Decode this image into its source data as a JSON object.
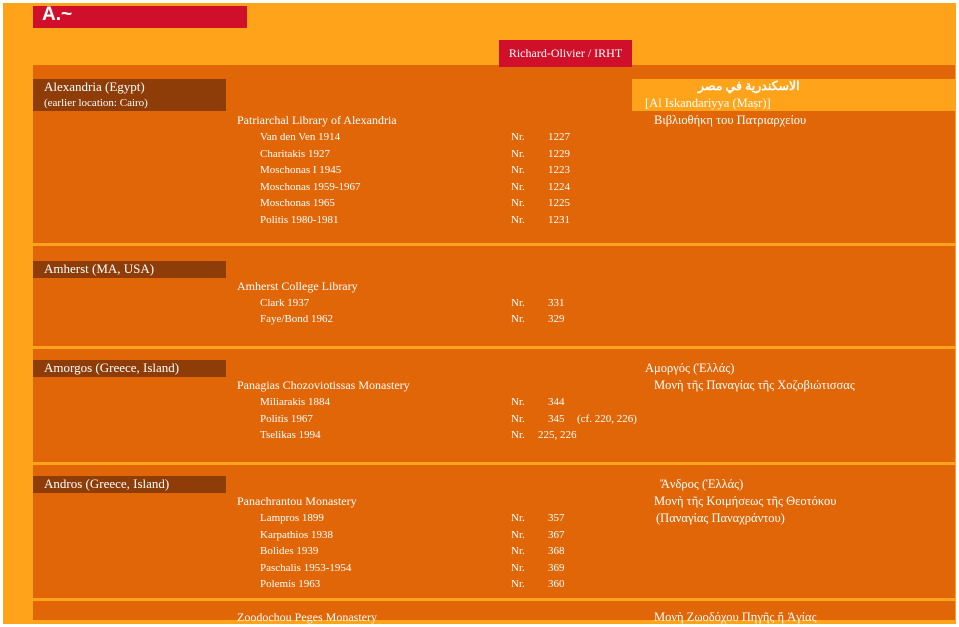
{
  "header": {
    "letter": "A.~"
  },
  "author_label": "Richard-Olivier / IRHT",
  "entries": [
    {
      "location": "Alexandria (Egypt)",
      "location_note": "(earlier location: Cairo)",
      "native_lines": [
        "الاسكندرية في مصر",
        "[Al Iskandariyya (Maṣr)]",
        "Βιβλιοθήκη του Πατριαρχείου"
      ],
      "libraries": [
        {
          "name": "Patriarchal Library of Alexandria",
          "refs": [
            {
              "author": "Van den Ven 1914",
              "prefix": "Nr.",
              "number": "1227",
              "note": ""
            },
            {
              "author": "Charitakis 1927",
              "prefix": "Nr.",
              "number": "1229",
              "note": ""
            },
            {
              "author": "Moschonas I 1945",
              "prefix": "Nr.",
              "number": "1223",
              "note": ""
            },
            {
              "author": "Moschonas 1959-1967",
              "prefix": "Nr.",
              "number": "1224",
              "note": ""
            },
            {
              "author": "Moschonas 1965",
              "prefix": "Nr.",
              "number": "1225",
              "note": ""
            },
            {
              "author": "Politis 1980-1981",
              "prefix": "Nr.",
              "number": "1231",
              "note": ""
            }
          ]
        }
      ]
    },
    {
      "location": "Amherst (MA, USA)",
      "native_lines": [],
      "libraries": [
        {
          "name": "Amherst College Library",
          "refs": [
            {
              "author": "Clark 1937",
              "prefix": "Nr.",
              "number": "331",
              "note": ""
            },
            {
              "author": "Faye/Bond 1962",
              "prefix": "Nr.",
              "number": "329",
              "note": ""
            }
          ]
        }
      ]
    },
    {
      "location": "Amorgos (Greece, Island)",
      "native_lines": [
        "Αμοργός (Ἑλλάς)",
        "Μονὴ τῆς Παναγίας τῆς Χοζοβιώτισσας"
      ],
      "libraries": [
        {
          "name": "Panagias Chozoviotissas Monastery",
          "refs": [
            {
              "author": "Miliarakis 1884",
              "prefix": "Nr.",
              "number": "344",
              "note": ""
            },
            {
              "author": "Politis 1967",
              "prefix": "Nr.",
              "number": "345",
              "note": "(cf. 220, 226)"
            },
            {
              "author": "Tselikas 1994",
              "prefix": "Nr.",
              "number": "225, 226",
              "note": ""
            }
          ]
        }
      ]
    },
    {
      "location": "Andros (Greece, Island)",
      "native_lines": [
        "Ἄνδρος (Ἑλλάς)",
        "Μονὴ τῆς Κοιμήσεως τῆς Θεοτόκου",
        "(Παναγίας Παναχράντου)"
      ],
      "libraries": [
        {
          "name": "Panachrantou Monastery",
          "refs": [
            {
              "author": "Lampros 1899",
              "prefix": "Nr.",
              "number": "357",
              "note": ""
            },
            {
              "author": "Karpathios 1938",
              "prefix": "Nr.",
              "number": "367",
              "note": ""
            },
            {
              "author": "Bolides 1939",
              "prefix": "Nr.",
              "number": "368",
              "note": ""
            },
            {
              "author": "Paschalis 1953-1954",
              "prefix": "Nr.",
              "number": "369",
              "note": ""
            },
            {
              "author": "Polemis 1963",
              "prefix": "Nr.",
              "number": "360",
              "note": ""
            }
          ]
        },
        {
          "name": "Zoodochou Peges Monastery",
          "native": "Μονὴ Ζωοδόχου Πηγῆς ἤ Ἁγίας",
          "refs": []
        }
      ]
    }
  ]
}
